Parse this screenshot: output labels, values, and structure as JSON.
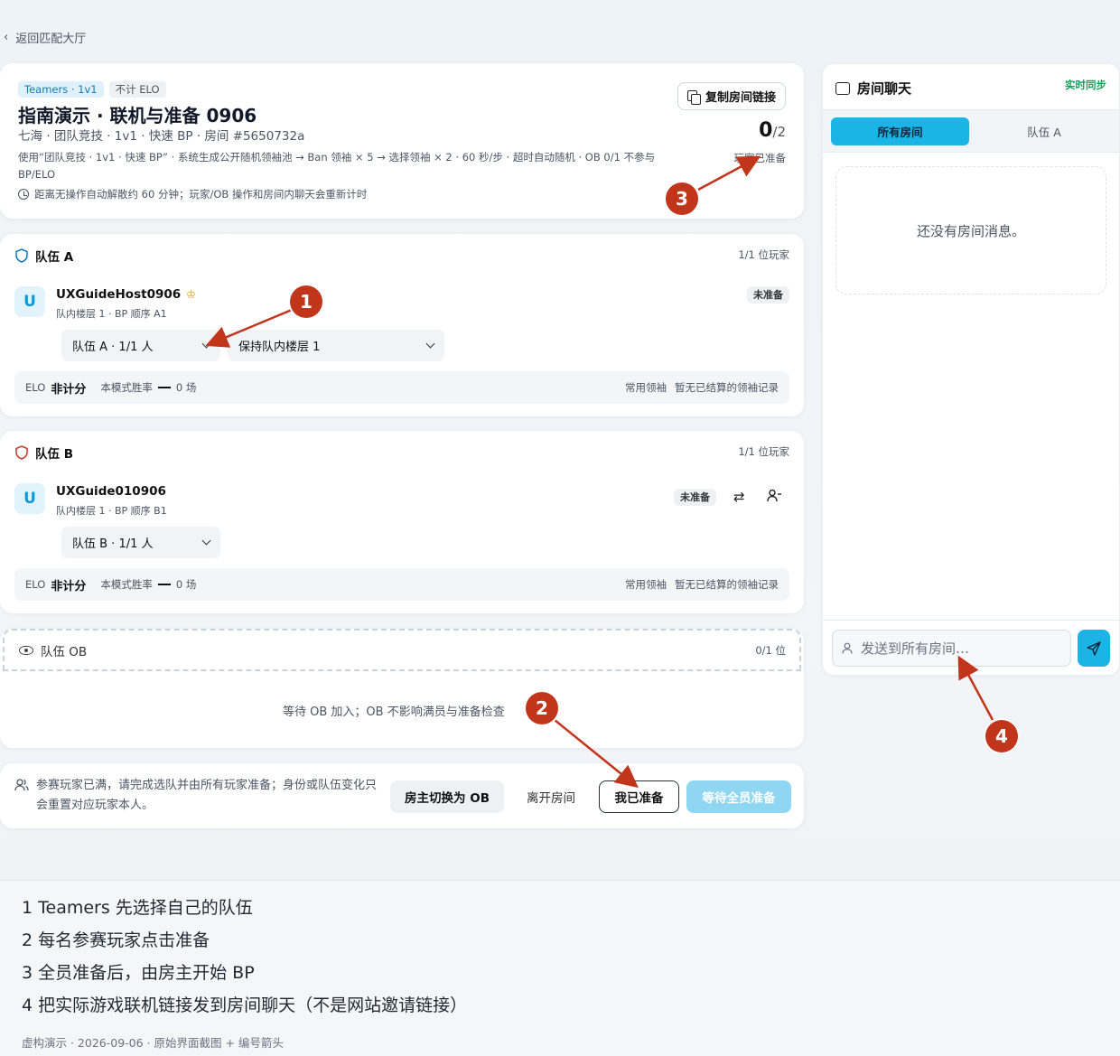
{
  "nav": {
    "back_label": "返回匹配大厅"
  },
  "room": {
    "tag_mode": "Teamers · 1v1",
    "tag_elo": "不计 ELO",
    "title": "指南演示 · 联机与准备 0906",
    "subtitle": "七海 · 团队竞技 · 1v1 · 快速 BP · 房间 #5650732a",
    "description": "使用“团队竞技 · 1v1 · 快速 BP” · 系统生成公开随机领袖池 → Ban 领袖 × 5 → 选择领袖 × 2 · 60 秒/步 · 超时自动随机 · OB 0/1 不参与 BP/ELO",
    "notice": "距离无操作自动解散约 60 分钟；玩家/OB 操作和房间内聊天会重新计时",
    "copy_button": "复制房间链接",
    "ready_count": "0",
    "ready_total": "/2",
    "ready_label": "玩家已准备"
  },
  "team_a": {
    "name": "队伍 A",
    "count": "1/1 位玩家",
    "player": {
      "avatar": "U",
      "name": "UXGuideHost0906",
      "meta": "队内楼层 1 · BP 顺序 A1",
      "status": "未准备"
    },
    "team_select": "队伍 A · 1/1 人",
    "floor_select": "保持队内楼层 1",
    "elo_label": "ELO",
    "elo_value": "非计分",
    "winrate_label": "本模式胜率",
    "winrate_games": "0 场",
    "leader_label": "常用领袖",
    "leader_value": "暂无已结算的领袖记录"
  },
  "team_b": {
    "name": "队伍 B",
    "count": "1/1 位玩家",
    "player": {
      "avatar": "U",
      "name": "UXGuide010906",
      "meta": "队内楼层 1 · BP 顺序 B1",
      "status": "未准备"
    },
    "team_select": "队伍 B · 1/1 人",
    "elo_label": "ELO",
    "elo_value": "非计分",
    "winrate_label": "本模式胜率",
    "winrate_games": "0 场",
    "leader_label": "常用领袖",
    "leader_value": "暂无已结算的领袖记录"
  },
  "team_ob": {
    "name": "队伍 OB",
    "count": "0/1 位",
    "message": "等待 OB 加入；OB 不影响满员与准备检查"
  },
  "actions": {
    "message": "参赛玩家已满，请完成选队并由所有玩家准备；身份或队伍变化只会重置对应玩家本人。",
    "switch_ob": "房主切换为 OB",
    "leave": "离开房间",
    "ready": "我已准备",
    "wait_all": "等待全员准备"
  },
  "chat": {
    "title": "房间聊天",
    "sync": "实时同步",
    "tab_all": "所有房间",
    "tab_team": "队伍 A",
    "empty": "还没有房间消息。",
    "input_placeholder": "发送到所有房间…"
  },
  "annotations": {
    "markers": [
      "1",
      "2",
      "3",
      "4"
    ],
    "color": "#c1351b"
  },
  "footer": {
    "steps": [
      "1 Teamers 先选择自己的队伍",
      "2 每名参赛玩家点击准备",
      "3 全员准备后，由房主开始 BP",
      "4 把实际游戏联机链接发到房间聊天（不是网站邀请链接）"
    ],
    "caption": "虚构演示 · 2026-09-06 · 原始界面截图 + 编号箭头"
  },
  "colors": {
    "accent": "#1ab4e6",
    "success": "#10a35a",
    "marker": "#c1351b"
  }
}
